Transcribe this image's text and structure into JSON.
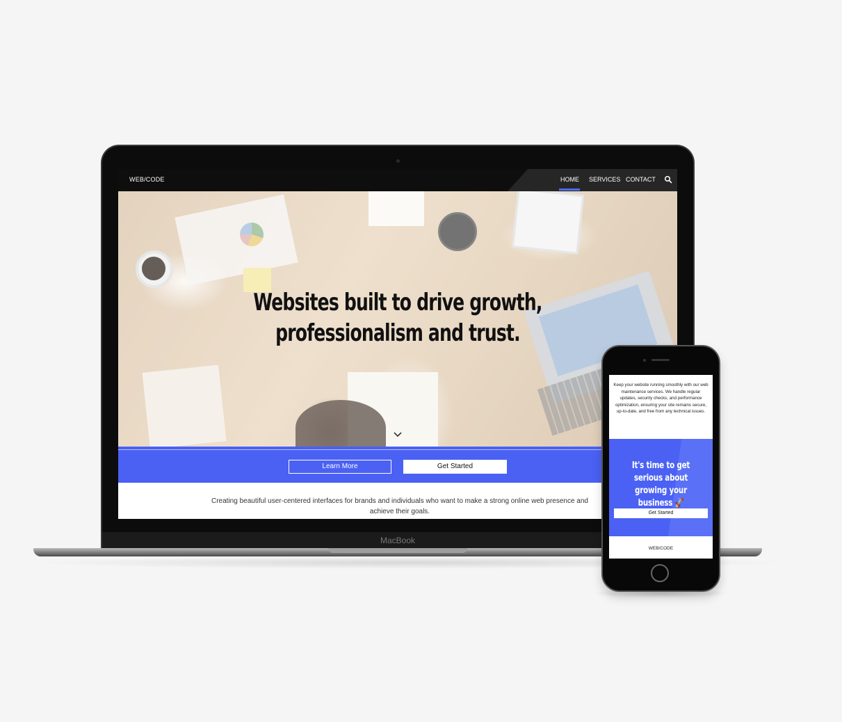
{
  "laptop": {
    "brand_label": "MacBook",
    "site": {
      "logo": "WEB/CODE",
      "nav": {
        "home": "HOME",
        "services": "SERVICES",
        "contact": "CONTACT"
      },
      "hero_title_line1": "Websites built to drive growth,",
      "hero_title_line2": "professionalism and trust.",
      "buttons": {
        "learn_more": "Learn More",
        "get_started": "Get Started"
      },
      "tagline_line1": "Creating beautiful user-centered interfaces for brands and individuals who want to make a strong online web presence and",
      "tagline_line2": "achieve their goals."
    }
  },
  "phone": {
    "maintenance_text": "Keep your website running smoothly with our web maintenance services. We handle regular updates, security checks, and performance optimization, ensuring your site remains secure, up-to-date, and free from any technical issues.",
    "cta_heading": "It's time to get serious about growing your business 🚀",
    "cta_button": "Get Started",
    "footer_logo": "WEB/CODE"
  },
  "colors": {
    "accent": "#4a61f4",
    "nav_bg": "#0e0e0e",
    "page_bg": "#f5f5f5"
  }
}
